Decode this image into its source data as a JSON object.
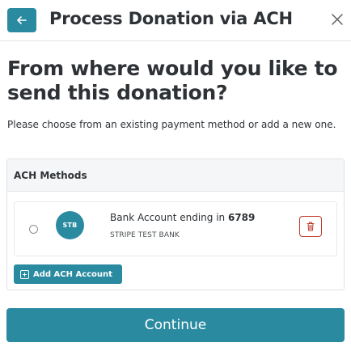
{
  "header": {
    "back_icon": "arrow-left-icon",
    "title": "Process Donation via ACH",
    "close_icon": "close-icon"
  },
  "main": {
    "question": "From where would you like to send this donation?",
    "description": "Please choose from an existing payment method or add a new one."
  },
  "ach_panel": {
    "title": "ACH Methods",
    "methods": [
      {
        "logo_text": "STB",
        "account_prefix": "Bank Account ending in ",
        "account_last4": "6789",
        "bank_name": "STRIPE TEST BANK",
        "selected": false,
        "delete_icon": "trash-icon"
      }
    ],
    "add_button_label": "Add ACH Account",
    "add_icon": "plus-square-icon"
  },
  "footer": {
    "continue_label": "Continue"
  },
  "colors": {
    "accent": "#2a8aa0",
    "danger": "#c0392b",
    "text": "#2e3236"
  }
}
